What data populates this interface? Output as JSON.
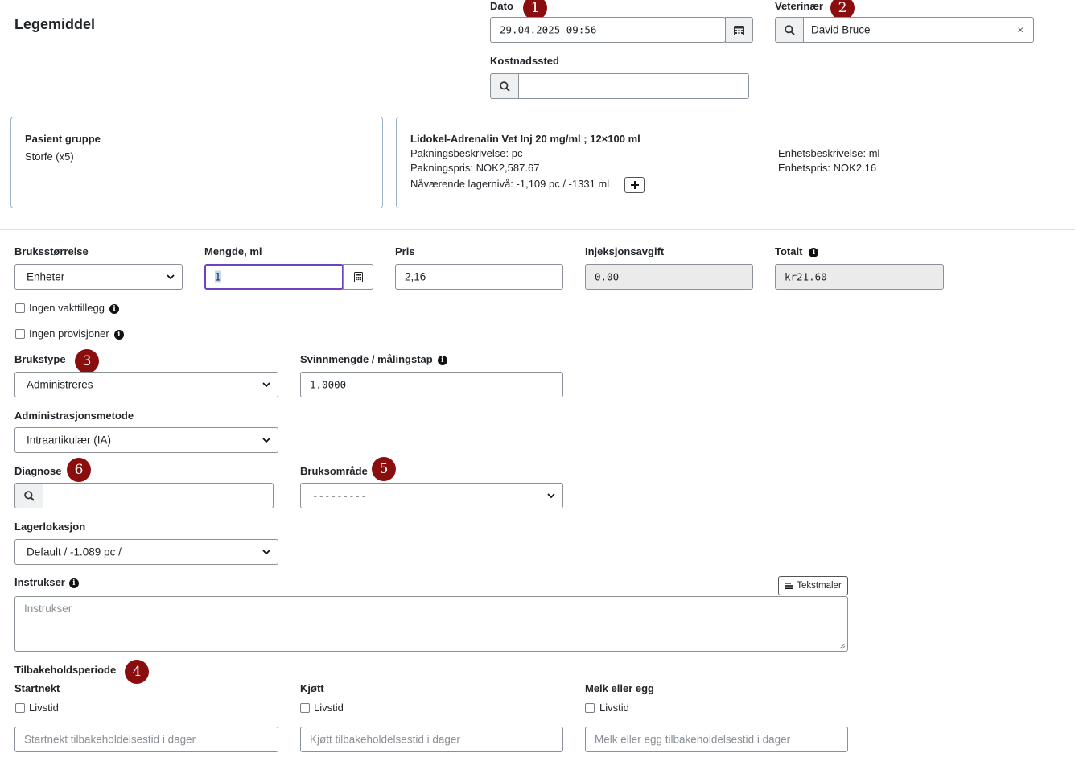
{
  "title": "Legemiddel",
  "dato": {
    "label": "Dato",
    "value": "29.04.2025 09:56",
    "badge": "1"
  },
  "veterinaer": {
    "label": "Veterinær",
    "value": "David Bruce",
    "badge": "2",
    "clear": "×"
  },
  "kostnadssted": {
    "label": "Kostnadssted",
    "value": ""
  },
  "patient": {
    "title": "Pasient gruppe",
    "value": "Storfe (x5)"
  },
  "product": {
    "name": "Lidokel-Adrenalin Vet Inj 20 mg/ml ; 12×100 ml",
    "pakningsbeskrivelse": "Pakningsbeskrivelse: pc",
    "pakningspris": "Pakningspris: NOK2,587.67",
    "lagerniva": "Nåværende lagernivå: -1,109 pc / -1331 ml",
    "enhetsbeskrivelse": "Enhetsbeskrivelse: ml",
    "enhetspris": "Enhetspris: NOK2.16"
  },
  "bruksstorrelse": {
    "label": "Bruksstørrelse",
    "value": "Enheter"
  },
  "mengde": {
    "label": "Mengde, ml",
    "value": "1"
  },
  "pris": {
    "label": "Pris",
    "value": "2,16"
  },
  "injeksjonsavgift": {
    "label": "Injeksjonsavgift",
    "value": "0.00"
  },
  "totalt": {
    "label": "Totalt",
    "value": "kr21.60"
  },
  "checkboxes": {
    "vakttillegg": "Ingen vakttillegg",
    "provisjoner": "Ingen provisjoner"
  },
  "brukstype": {
    "label": "Brukstype",
    "value": "Administreres",
    "badge": "3"
  },
  "svinn": {
    "label": "Svinnmengde / målingstap",
    "value": "1,0000"
  },
  "adminmetode": {
    "label": "Administrasjonsmetode",
    "value": "Intraartikulær (IA)"
  },
  "diagnose": {
    "label": "Diagnose",
    "value": "",
    "badge": "6"
  },
  "bruksomrade": {
    "label": "Bruksområde",
    "value": "---------",
    "badge": "5"
  },
  "lagerlokasjon": {
    "label": "Lagerlokasjon",
    "value": "Default / -1.089 pc /"
  },
  "instrukser": {
    "label": "Instrukser",
    "placeholder": "Instrukser",
    "tekstmaler": "Tekstmaler"
  },
  "tilbakehold": {
    "label": "Tilbakeholdsperiode",
    "badge": "4",
    "livstid": "Livstid",
    "startnekt": {
      "label": "Startnekt",
      "placeholder": "Startnekt tilbakeholdelsestid i dager"
    },
    "kjott": {
      "label": "Kjøtt",
      "placeholder": "Kjøtt tilbakeholdelsestid i dager"
    },
    "melk": {
      "label": "Melk eller egg",
      "placeholder": "Melk eller egg tilbakeholdelsestid i dager"
    }
  },
  "icons": {
    "info": "i",
    "search": "search-icon",
    "calendar": "calendar-icon",
    "calculator": "calculator-icon",
    "plus": "plus-icon",
    "chevron": "chevron-down-icon",
    "text-lines": "text-lines-icon"
  },
  "colors": {
    "badge": "#8b0e0e",
    "focus_border": "#6f42c1",
    "card_border": "#9fb3c8",
    "readonly_bg": "#ebebeb"
  }
}
